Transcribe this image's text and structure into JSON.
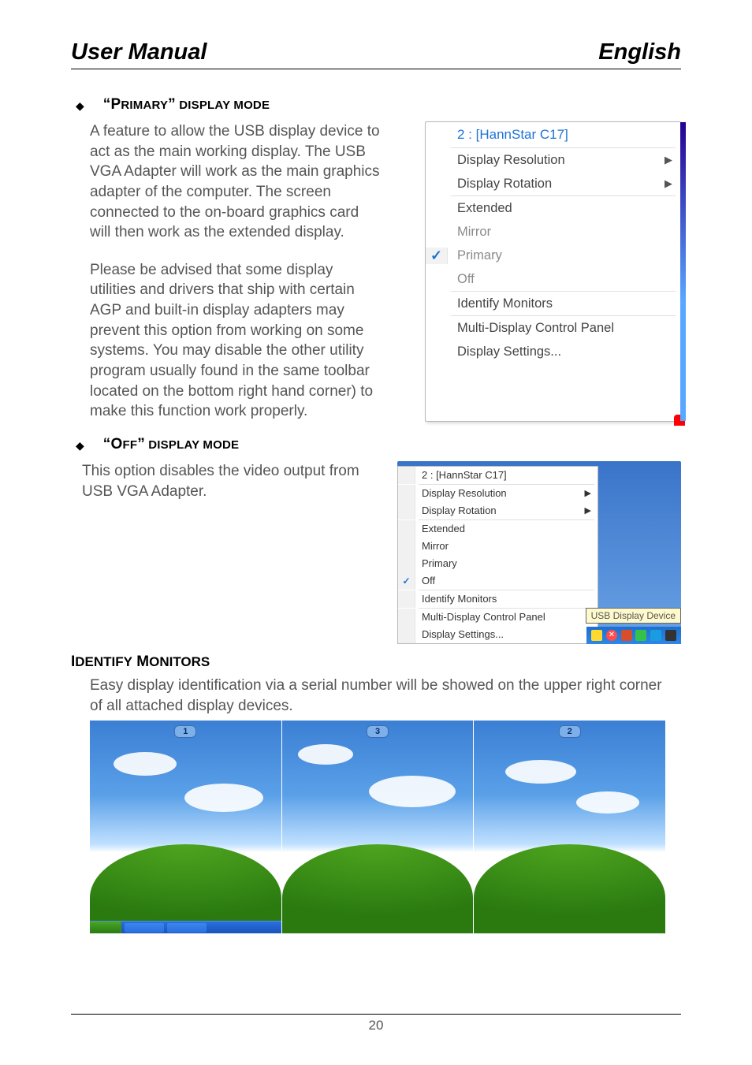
{
  "header": {
    "left": "User Manual",
    "right": "English"
  },
  "section_primary": {
    "heading_quote_open": "“",
    "heading_big": "P",
    "heading_rest": "RIMARY",
    "heading_quote_close": "”",
    "heading_tail_big": " DISPLAY MODE",
    "para1": "A feature to allow the USB display device to act as the main working display. The USB VGA Adapter will work as the main graphics adapter of the computer. The screen connected to the on-board  graphics card will then work as the extended display.",
    "para2": "Please be advised that some display utilities and drivers that ship with certain AGP and built-in display adapters may prevent this option from working on some systems. You may disable the other utility program usually found in the same toolbar located on the bottom right hand corner) to make this function work properly."
  },
  "menu1": {
    "title": "2 : [HannStar C17]",
    "resolution": "Display Resolution",
    "rotation": "Display Rotation",
    "extended": "Extended",
    "mirror": "Mirror",
    "primary": "Primary",
    "off": "Off",
    "identify": "Identify Monitors",
    "mdcp": "Multi-Display Control Panel",
    "settings": "Display Settings...",
    "checked": "primary"
  },
  "section_off": {
    "heading_quote_open": "“",
    "heading_big": "O",
    "heading_rest": "FF",
    "heading_quote_close": "”",
    "heading_tail_big": " DISPLAY MODE",
    "para": "This option disables the video output from USB VGA Adapter."
  },
  "menu2": {
    "title": "2 : [HannStar C17]",
    "resolution": "Display Resolution",
    "rotation": "Display Rotation",
    "extended": "Extended",
    "mirror": "Mirror",
    "primary": "Primary",
    "off": "Off",
    "identify": "Identify Monitors",
    "mdcp": "Multi-Display Control Panel",
    "settings": "Display Settings...",
    "checked": "off",
    "tooltip": "USB Display Device"
  },
  "identify": {
    "heading_big1": "I",
    "heading_rest1": "DENTIFY",
    "heading_big2": " M",
    "heading_rest2": "ONITORS",
    "para1": "Easy display identification via a serial number will be showed on the upper right corner",
    "para2": "of all attached display devices.",
    "badges": [
      "1",
      "3",
      "2"
    ]
  },
  "footer": {
    "page": "20"
  }
}
